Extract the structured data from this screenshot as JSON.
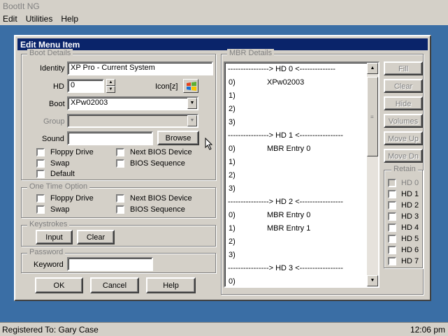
{
  "app": {
    "title": "BootIt NG"
  },
  "menu": [
    "Edit",
    "Utilities",
    "Help"
  ],
  "status": {
    "registered": "Registered To: Gary Case",
    "time": "12:06 pm"
  },
  "dialog": {
    "title": "Edit Menu Item",
    "boot_details": {
      "legend": "Boot Details",
      "identity_label": "Identity",
      "identity_value": "XP Pro - Current System",
      "hd_label": "HD",
      "hd_value": "0",
      "icon_label": "Icon[z]",
      "boot_label": "Boot",
      "boot_value": "XPw02003",
      "group_label": "Group",
      "group_value": "",
      "sound_label": "Sound",
      "sound_value": "",
      "browse_label": "Browse",
      "checkboxes": [
        {
          "label": "Floppy Drive",
          "checked": false
        },
        {
          "label": "Next BIOS Device",
          "checked": false
        },
        {
          "label": "Swap",
          "checked": false
        },
        {
          "label": "BIOS Sequence",
          "checked": false
        },
        {
          "label": "Default",
          "checked": false
        }
      ]
    },
    "one_time": {
      "legend": "One Time Option",
      "checkboxes": [
        {
          "label": "Floppy Drive",
          "checked": false
        },
        {
          "label": "Next BIOS Device",
          "checked": false
        },
        {
          "label": "Swap",
          "checked": false
        },
        {
          "label": "BIOS Sequence",
          "checked": false
        }
      ]
    },
    "keystrokes": {
      "legend": "Keystrokes",
      "input_label": "Input",
      "clear_label": "Clear"
    },
    "password": {
      "legend": "Password",
      "keyword_label": "Keyword",
      "keyword_value": ""
    },
    "buttons": {
      "ok": "OK",
      "cancel": "Cancel",
      "help": "Help"
    },
    "mbr": {
      "legend": "MBR Details",
      "rows": [
        {
          "type": "header",
          "text": "----------------> HD 0 <--------------"
        },
        {
          "type": "entry",
          "num": "0)",
          "name": "XPw02003"
        },
        {
          "type": "entry",
          "num": "1)",
          "name": ""
        },
        {
          "type": "entry",
          "num": "2)",
          "name": ""
        },
        {
          "type": "entry",
          "num": "3)",
          "name": ""
        },
        {
          "type": "header",
          "text": "----------------> HD 1 <-----------------"
        },
        {
          "type": "entry",
          "num": "0)",
          "name": "MBR Entry 0"
        },
        {
          "type": "entry",
          "num": "1)",
          "name": ""
        },
        {
          "type": "entry",
          "num": "2)",
          "name": ""
        },
        {
          "type": "entry",
          "num": "3)",
          "name": ""
        },
        {
          "type": "header",
          "text": "----------------> HD 2 <-----------------"
        },
        {
          "type": "entry",
          "num": "0)",
          "name": "MBR Entry 0"
        },
        {
          "type": "entry",
          "num": "1)",
          "name": "MBR Entry 1"
        },
        {
          "type": "entry",
          "num": "2)",
          "name": ""
        },
        {
          "type": "entry",
          "num": "3)",
          "name": ""
        },
        {
          "type": "header",
          "text": "----------------> HD 3 <-----------------"
        },
        {
          "type": "entry",
          "num": "0)",
          "name": ""
        }
      ],
      "side_buttons": [
        "Fill",
        "Clear",
        "Hide",
        "Volumes",
        "Move Up",
        "Move Dn"
      ],
      "side_buttons_disabled": [
        true,
        false,
        true,
        false,
        true,
        true
      ],
      "retain_legend": "Retain",
      "retain": [
        {
          "label": "HD 0",
          "checked": false,
          "disabled": true
        },
        {
          "label": "HD 1",
          "checked": false,
          "disabled": false
        },
        {
          "label": "HD 2",
          "checked": false,
          "disabled": false
        },
        {
          "label": "HD 3",
          "checked": false,
          "disabled": false
        },
        {
          "label": "HD 4",
          "checked": false,
          "disabled": false
        },
        {
          "label": "HD 5",
          "checked": false,
          "disabled": false
        },
        {
          "label": "HD 6",
          "checked": false,
          "disabled": false
        },
        {
          "label": "HD 7",
          "checked": false,
          "disabled": false
        }
      ]
    }
  }
}
